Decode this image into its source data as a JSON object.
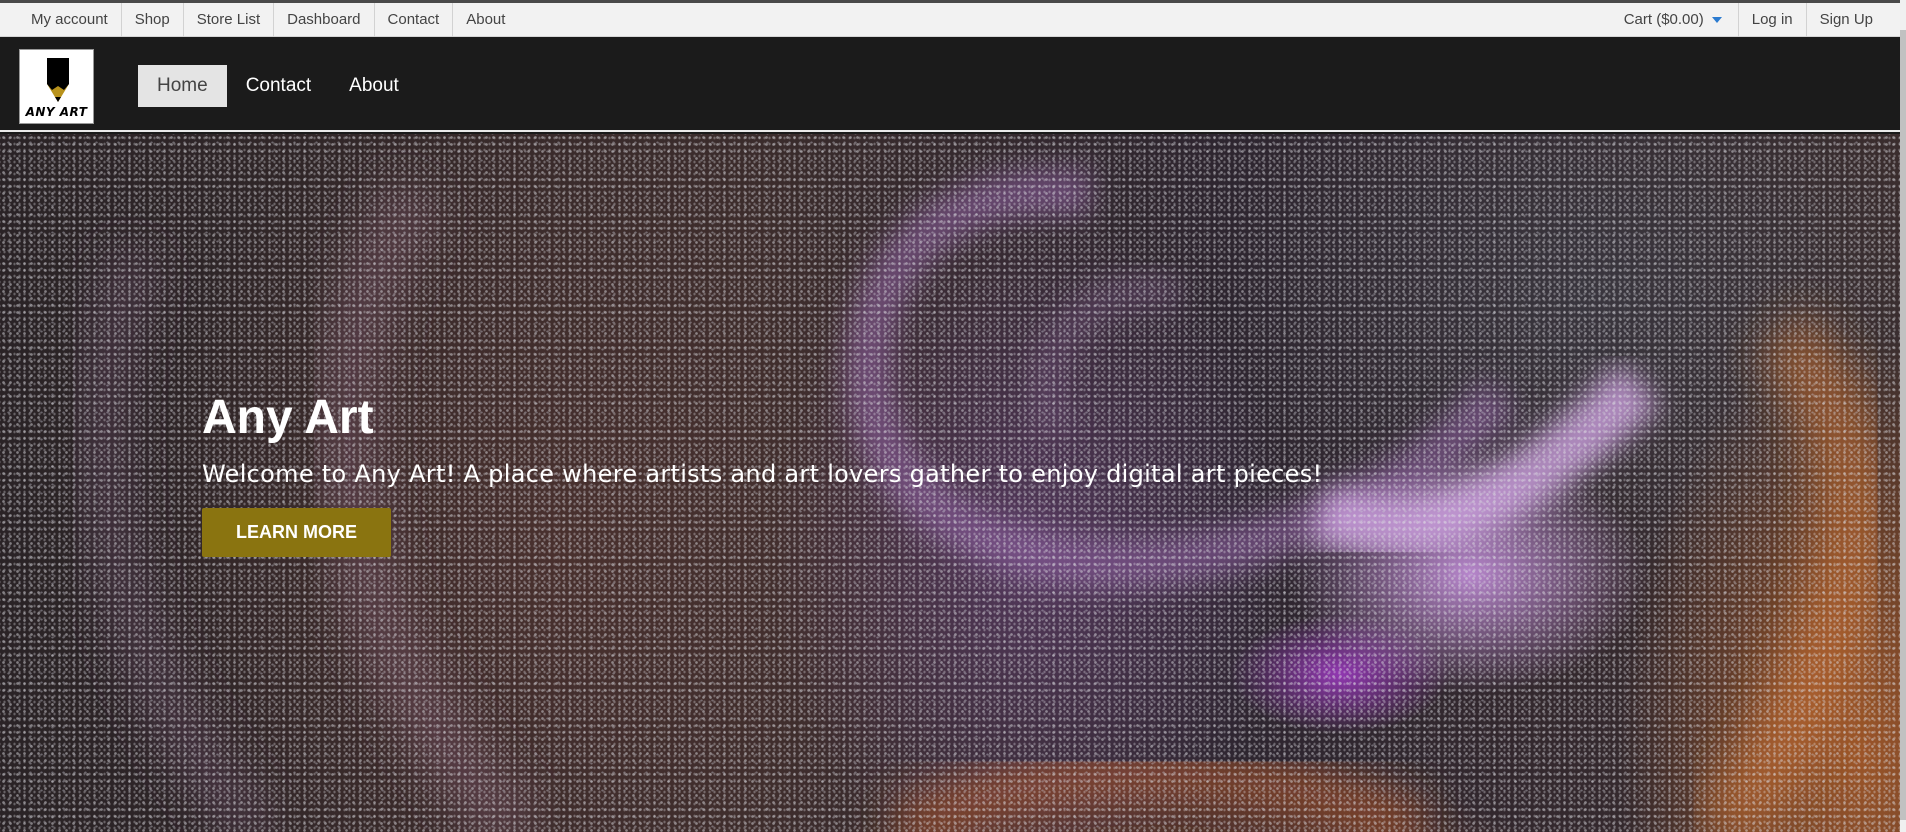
{
  "topbar": {
    "left_links": [
      {
        "label": "My account"
      },
      {
        "label": "Shop"
      },
      {
        "label": "Store List"
      },
      {
        "label": "Dashboard"
      },
      {
        "label": "Contact"
      },
      {
        "label": "About"
      }
    ],
    "cart_label": "Cart ($0.00)",
    "login_label": "Log in",
    "signup_label": "Sign Up"
  },
  "header": {
    "logo_text": "ANY ART",
    "nav": [
      {
        "label": "Home",
        "active": true
      },
      {
        "label": "Contact"
      },
      {
        "label": "About"
      }
    ]
  },
  "hero": {
    "title": "Any Art",
    "subtitle": "Welcome to Any Art! A place where artists and art lovers gather to enjoy digital art pieces!",
    "button_label": "LEARN MORE"
  },
  "colors": {
    "accent_button": "#8a7410",
    "header_bg": "#1b1b1b",
    "topbar_bg": "#f2f2f2",
    "caret": "#2b7bd0"
  },
  "icons": {
    "cart_dropdown": "chevron-down-icon",
    "logo": "pencil-logo-icon"
  }
}
